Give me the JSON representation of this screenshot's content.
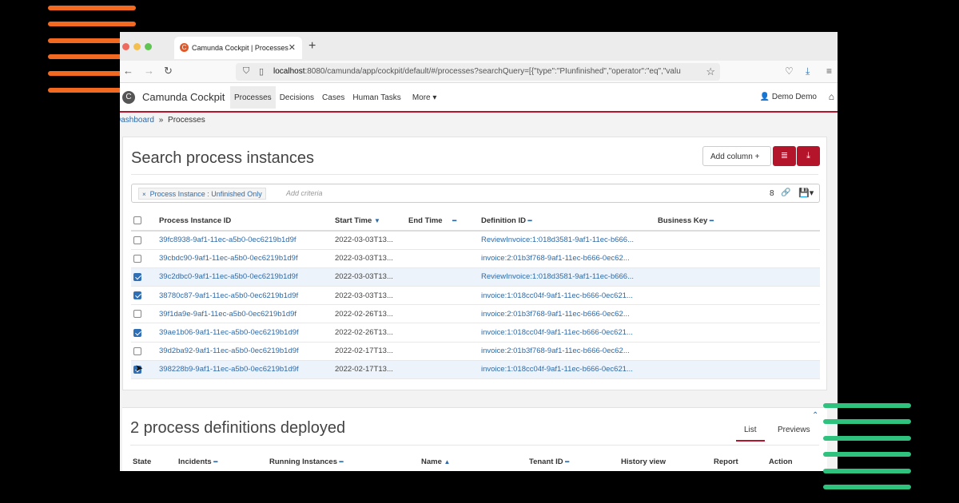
{
  "browser": {
    "tab_title": "Camunda Cockpit | Processes",
    "url_host": "localhost",
    "url_rest": ":8080/camunda/app/cockpit/default/#/processes?searchQuery=[{\"type\":\"PIunfinished\",\"operator\":\"eq\",\"valu"
  },
  "app": {
    "brand": "Camunda Cockpit",
    "menu": [
      "Processes",
      "Decisions",
      "Cases",
      "Human Tasks",
      "More ▾"
    ],
    "user": "Demo Demo"
  },
  "breadcrumb": {
    "dashboard": "Dashboard",
    "separator": "»",
    "current": "Processes"
  },
  "search": {
    "title": "Search process instances",
    "add_column": "Add column +",
    "criteria_pill": "Process Instance : Unfinished Only",
    "add_criteria_placeholder": "Add criteria",
    "count": "8"
  },
  "table": {
    "headers": [
      "Process Instance ID",
      "Start Time",
      "End Time",
      "Definition ID",
      "Business Key"
    ],
    "rows": [
      {
        "checked": false,
        "id": "39fc8938-9af1-11ec-a5b0-0ec6219b1d9f",
        "start": "2022-03-03T13...",
        "end": "",
        "def": "ReviewInvoice:1:018d3581-9af1-11ec-b666...",
        "key": ""
      },
      {
        "checked": false,
        "id": "39cbdc90-9af1-11ec-a5b0-0ec6219b1d9f",
        "start": "2022-03-03T13...",
        "end": "",
        "def": "invoice:2:01b3f768-9af1-11ec-b666-0ec62...",
        "key": ""
      },
      {
        "checked": true,
        "id": "39c2dbc0-9af1-11ec-a5b0-0ec6219b1d9f",
        "start": "2022-03-03T13...",
        "end": "",
        "def": "ReviewInvoice:1:018d3581-9af1-11ec-b666...",
        "key": ""
      },
      {
        "checked": true,
        "id": "38780c87-9af1-11ec-a5b0-0ec6219b1d9f",
        "start": "2022-03-03T13...",
        "end": "",
        "def": "invoice:1:018cc04f-9af1-11ec-b666-0ec621...",
        "key": ""
      },
      {
        "checked": false,
        "id": "39f1da9e-9af1-11ec-a5b0-0ec6219b1d9f",
        "start": "2022-02-26T13...",
        "end": "",
        "def": "invoice:2:01b3f768-9af1-11ec-b666-0ec62...",
        "key": ""
      },
      {
        "checked": true,
        "id": "39ae1b06-9af1-11ec-a5b0-0ec6219b1d9f",
        "start": "2022-02-26T13...",
        "end": "",
        "def": "invoice:1:018cc04f-9af1-11ec-b666-0ec621...",
        "key": ""
      },
      {
        "checked": false,
        "id": "39d2ba92-9af1-11ec-a5b0-0ec6219b1d9f",
        "start": "2022-02-17T13...",
        "end": "",
        "def": "invoice:2:01b3f768-9af1-11ec-b666-0ec62...",
        "key": ""
      },
      {
        "checked": true,
        "id": "398228b9-9af1-11ec-a5b0-0ec6219b1d9f",
        "start": "2022-02-17T13...",
        "end": "",
        "def": "invoice:1:018cc04f-9af1-11ec-b666-0ec621...",
        "key": ""
      }
    ]
  },
  "deployments": {
    "title": "2 process definitions deployed",
    "tabs": [
      "List",
      "Previews"
    ],
    "headers": [
      "State",
      "Incidents",
      "Running Instances",
      "Name",
      "Tenant ID",
      "History view",
      "Report",
      "Action"
    ]
  },
  "colors": {
    "accent": "#b5152b",
    "link": "#2f6aa8",
    "deco_orange": "#f26a21",
    "deco_green": "#2ec27e"
  }
}
